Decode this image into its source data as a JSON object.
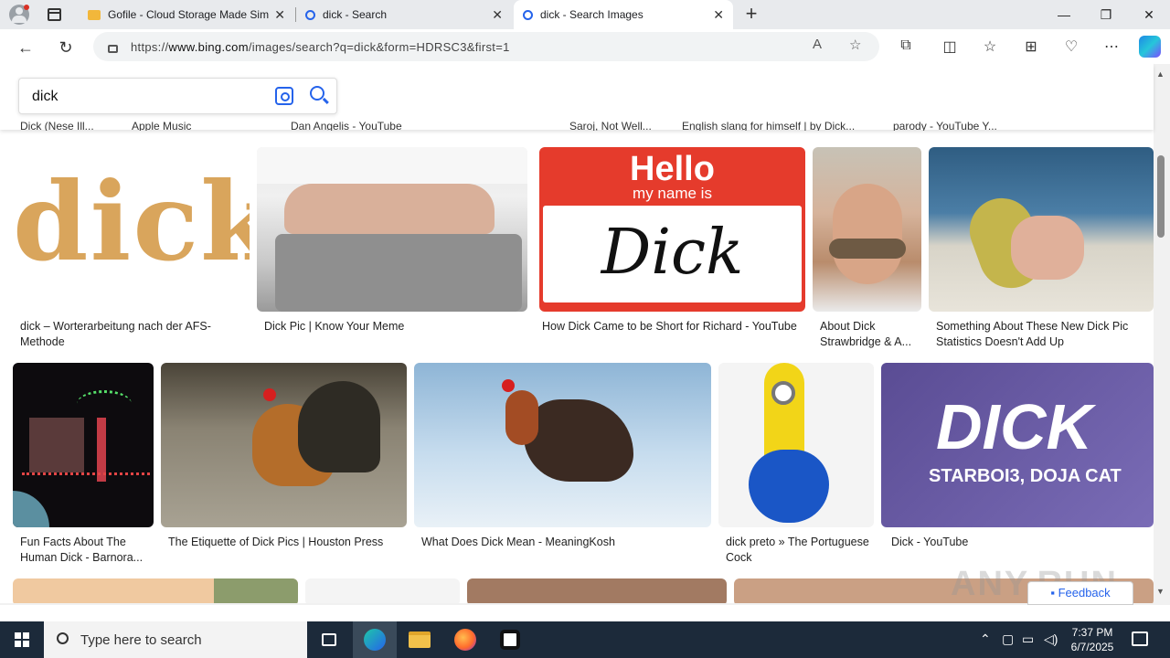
{
  "browser": {
    "tabs": [
      {
        "title": "Gofile - Cloud Storage Made Sim",
        "active": false
      },
      {
        "title": "dick - Search",
        "active": false
      },
      {
        "title": "dick - Search Images",
        "active": true
      }
    ],
    "url_prefix": "https://",
    "url_domain": "www.bing.com",
    "url_path": "/images/search?q=dick&form=HDRSC3&first=1",
    "accent": "#2563eb"
  },
  "search": {
    "query": "dick"
  },
  "cut_captions": [
    "Dick (Nese Ill...",
    "Apple Music",
    "Dan Angelis - YouTube",
    "Saroj, Not Well...",
    "English slang for himself | by Dick...",
    "parody - YouTube Y..."
  ],
  "rows": [
    {
      "tiles": [
        {
          "caption": "dick – Worterarbeitung nach der AFS-Methode"
        },
        {
          "caption": "Dick Pic | Know Your Meme"
        },
        {
          "caption": "How Dick Came to be Short for Richard - YouTube",
          "hello": "Hello",
          "my_name": "my name is",
          "name": "Dick"
        },
        {
          "caption": "About Dick Strawbridge & A..."
        },
        {
          "caption": "Something About These New Dick Pic Statistics Doesn't Add Up"
        }
      ]
    },
    {
      "tiles": [
        {
          "caption": "Fun Facts About The Human Dick - Barnora..."
        },
        {
          "caption": "The Etiquette of Dick Pics | Houston Press"
        },
        {
          "caption": "What Does Dick Mean - MeaningKosh"
        },
        {
          "caption": "dick preto » The Portuguese Cock"
        },
        {
          "caption": "Dick - YouTube",
          "art_title": "DICK",
          "art_sub": "STARBOI3, DOJA CAT"
        }
      ]
    }
  ],
  "row1_tile1_word": "dick",
  "feedback_label": "Feedback",
  "watermark": "ANY.RUN",
  "taskbar": {
    "search_placeholder": "Type here to search",
    "time": "7:37 PM",
    "date": "6/7/2025"
  }
}
